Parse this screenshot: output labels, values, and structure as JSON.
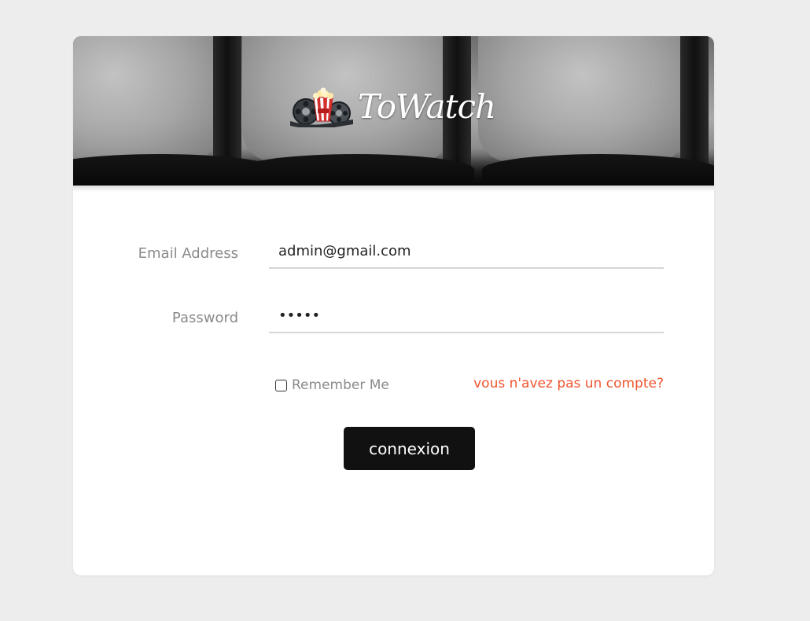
{
  "brand": {
    "name": "ToWatch",
    "logo_icon": "popcorn-film-reel-icon"
  },
  "form": {
    "email": {
      "label": "Email Address",
      "value": "admin@gmail.com"
    },
    "password": {
      "label": "Password",
      "value": "•••••"
    },
    "remember": {
      "label": "Remember Me",
      "checked": false
    },
    "signup_link": "vous n'avez pas un compte?",
    "submit_label": "connexion"
  },
  "colors": {
    "page_background": "#ededed",
    "card_background": "#ffffff",
    "link": "#f0542d",
    "button": "#111111",
    "button_text": "#ffffff",
    "label": "#8a8a8a"
  }
}
